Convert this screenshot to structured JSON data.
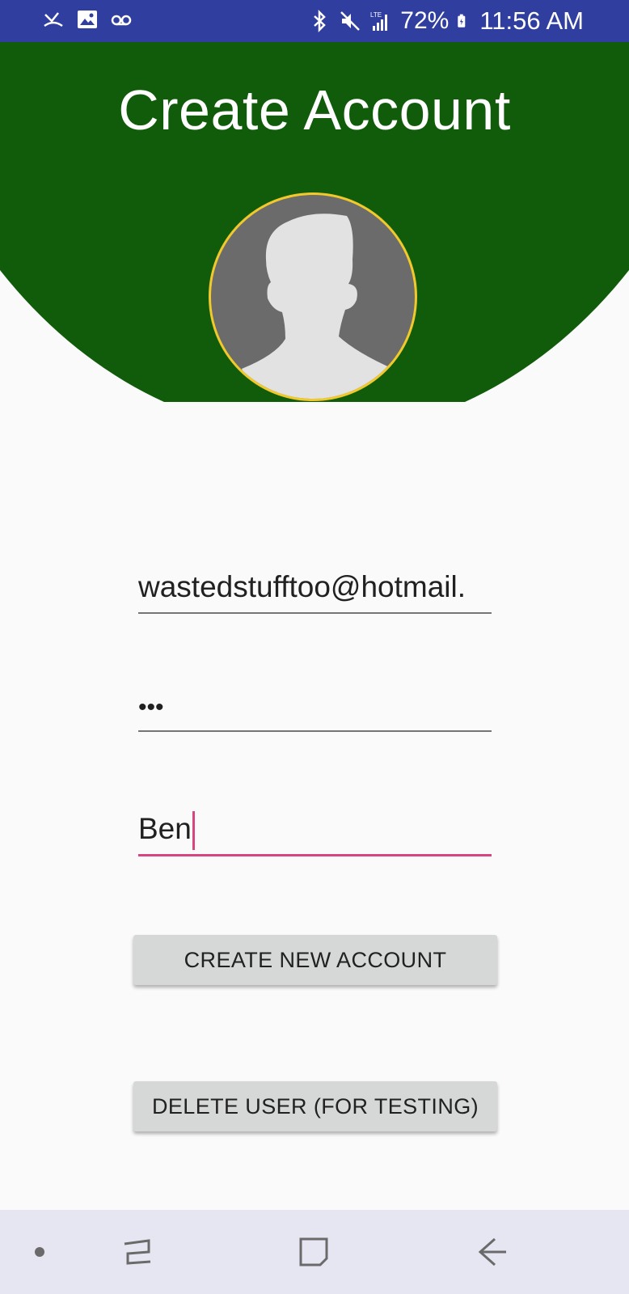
{
  "status_bar": {
    "left_icons": [
      "missed-call-icon",
      "image-icon",
      "voicemail-icon"
    ],
    "right_icons": [
      "bluetooth-icon",
      "mute-icon",
      "lte-signal-icon",
      "battery-icon"
    ],
    "battery_text": "72%",
    "lte_label": "LTE",
    "time": "11:56 AM"
  },
  "header": {
    "title": "Create Account",
    "background_color": "#115c0b",
    "avatar_icon": "person-silhouette-icon"
  },
  "form": {
    "email_value": "wastedstufftoo@hotmail.",
    "password_value": "•••",
    "name_value": "Ben"
  },
  "buttons": {
    "create_label": "CREATE NEW ACCOUNT",
    "delete_label": "DELETE USER (FOR TESTING)"
  },
  "nav_bar": {
    "items": [
      "dot-icon",
      "recents-icon",
      "home-icon",
      "back-icon"
    ]
  },
  "colors": {
    "status_bar": "#303f9f",
    "accent": "#d9467f",
    "avatar_border": "#f2c92b"
  }
}
